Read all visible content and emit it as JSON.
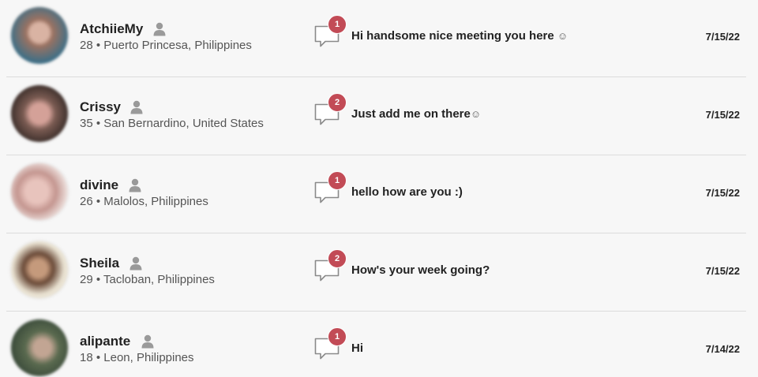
{
  "conversations": [
    {
      "name": "AtchiieMy",
      "details": "28 • Puerto Princesa, Philippines",
      "unread": "1",
      "message": "Hi handsome nice meeting you here",
      "smiley": "☺",
      "date": "7/15/22",
      "avatar_colors": [
        "#3f6f86",
        "#c9a08e",
        "#8a6a5a"
      ]
    },
    {
      "name": "Crissy",
      "details": "35 • San Bernardino, United States",
      "unread": "2",
      "message": "Just add me on there",
      "smiley": "☺",
      "date": "7/15/22",
      "avatar_colors": [
        "#5b4a44",
        "#c48e86",
        "#7a5b52"
      ]
    },
    {
      "name": "divine",
      "details": "26 • Malolos, Philippines",
      "unread": "1",
      "message": "hello how are you :)",
      "smiley": "",
      "date": "7/15/22",
      "avatar_colors": [
        "#e6d3cf",
        "#d9a9a3",
        "#b98a85"
      ]
    },
    {
      "name": "Sheila",
      "details": "29 • Tacloban, Philippines",
      "unread": "2",
      "message": "How's your week going?",
      "smiley": "",
      "date": "7/15/22",
      "avatar_colors": [
        "#e9e2d2",
        "#b98c6a",
        "#5a4030"
      ]
    },
    {
      "name": "alipante",
      "details": "18 • Leon, Philippines",
      "unread": "1",
      "message": "Hi",
      "smiley": "",
      "date": "7/14/22",
      "avatar_colors": [
        "#4f6b4a",
        "#c2a593",
        "#3a4a3a"
      ]
    }
  ],
  "colors": {
    "badge": "#c24b56",
    "divider": "#dcdcdc",
    "background": "#f7f7f7",
    "icon_gray": "#9a9a9a"
  },
  "icons": {
    "user": "user-icon",
    "message": "speech-bubble-icon"
  }
}
